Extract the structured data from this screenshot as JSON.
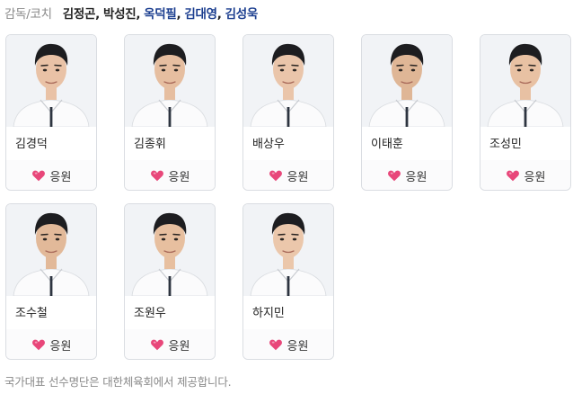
{
  "coaches": {
    "label": "감독/코치",
    "names": [
      {
        "name": "김정곤",
        "link": false
      },
      {
        "name": "박성진",
        "link": false
      },
      {
        "name": "옥덕필",
        "link": true
      },
      {
        "name": "김대영",
        "link": true
      },
      {
        "name": "김성욱",
        "link": true
      }
    ],
    "separator": ","
  },
  "players": [
    {
      "name": "김경덕",
      "cheer_label": "응원"
    },
    {
      "name": "김종휘",
      "cheer_label": "응원"
    },
    {
      "name": "배상우",
      "cheer_label": "응원"
    },
    {
      "name": "이태훈",
      "cheer_label": "응원"
    },
    {
      "name": "조성민",
      "cheer_label": "응원"
    },
    {
      "name": "조수철",
      "cheer_label": "응원"
    },
    {
      "name": "조원우",
      "cheer_label": "응원"
    },
    {
      "name": "하지민",
      "cheer_label": "응원"
    }
  ],
  "icons": {
    "cheer": "heart-icon",
    "photo": "player-photo"
  },
  "colors": {
    "heart": "#e8477a",
    "link": "#1a3d8f",
    "muted": "#8a8a8a"
  },
  "footer": "국가대표 선수명단은 대한체육회에서 제공합니다."
}
